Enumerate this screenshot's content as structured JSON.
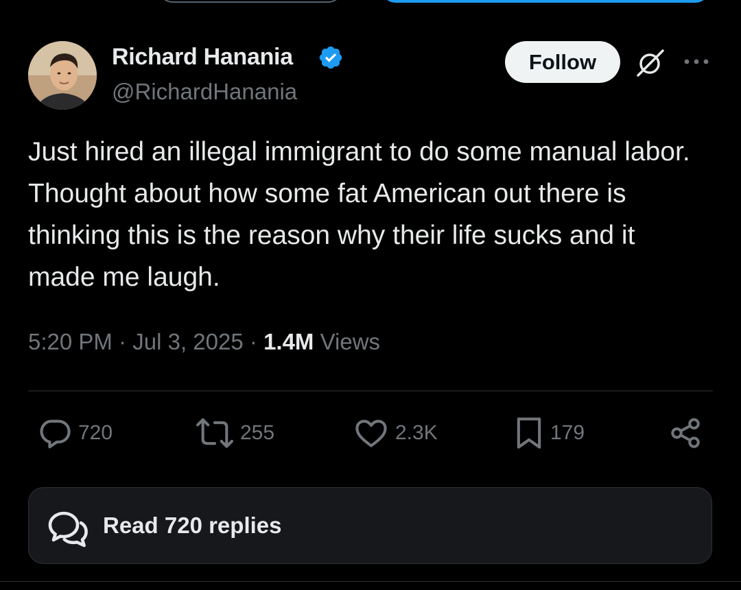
{
  "author": {
    "name": "Richard Hanania",
    "handle": "@RichardHanania",
    "verified": true,
    "verified_color": "#1d9bf0"
  },
  "header_actions": {
    "follow_label": "Follow",
    "grok_icon": "grok-icon",
    "more_icon": "more-dots-icon"
  },
  "tweet": {
    "text": "Just hired an illegal immigrant to do some manual labor. Thought about how some fat American out there is thinking this is the reason why their life sucks and it made me laugh.",
    "time": "5:20 PM",
    "date": "Jul 3, 2025",
    "views_count": "1.4M",
    "views_label": "Views",
    "separator": "·"
  },
  "engagement": {
    "replies": "720",
    "reposts": "255",
    "likes": "2.3K",
    "bookmarks": "179"
  },
  "replies_button": {
    "label": "Read 720 replies"
  },
  "theme": {
    "background": "#000000",
    "text_primary": "#e7e9ea",
    "text_secondary": "#71767b",
    "border": "#2f3336",
    "accent": "#1d9bf0"
  }
}
